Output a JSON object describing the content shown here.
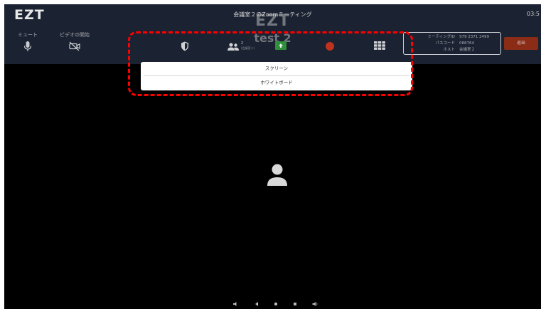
{
  "app": {
    "logo": "EZT",
    "meeting_title": "会議室２のZoomミーティング",
    "clock": "03:5",
    "watermark_logo": "EZT",
    "watermark_user": "test 2"
  },
  "toolbar": {
    "mute_label": "ミュート",
    "video_label": "ビデオの開始",
    "participant_count": "2",
    "participant_sub": "(会議室２)"
  },
  "meeting_info": {
    "meeting_id_label": "ミーティングID",
    "meeting_id": "979 2371 2499",
    "passcode_label": "パスコード",
    "passcode": "088764",
    "host_label": "ホスト",
    "host": "会議室２"
  },
  "leave_button": "退出",
  "share_menu": {
    "items": [
      "スクリーン",
      "ホワイトボード"
    ]
  },
  "colors": {
    "topbar": "#1b2231",
    "highlight": "#ff0000",
    "leave": "#8a2c16",
    "share_green": "#2f8f3a",
    "record_red": "#c0321d"
  },
  "icons": [
    "microphone-icon",
    "video-off-icon",
    "shield-icon",
    "participants-icon",
    "share-icon",
    "record-icon",
    "grid-icon",
    "avatar-icon"
  ]
}
